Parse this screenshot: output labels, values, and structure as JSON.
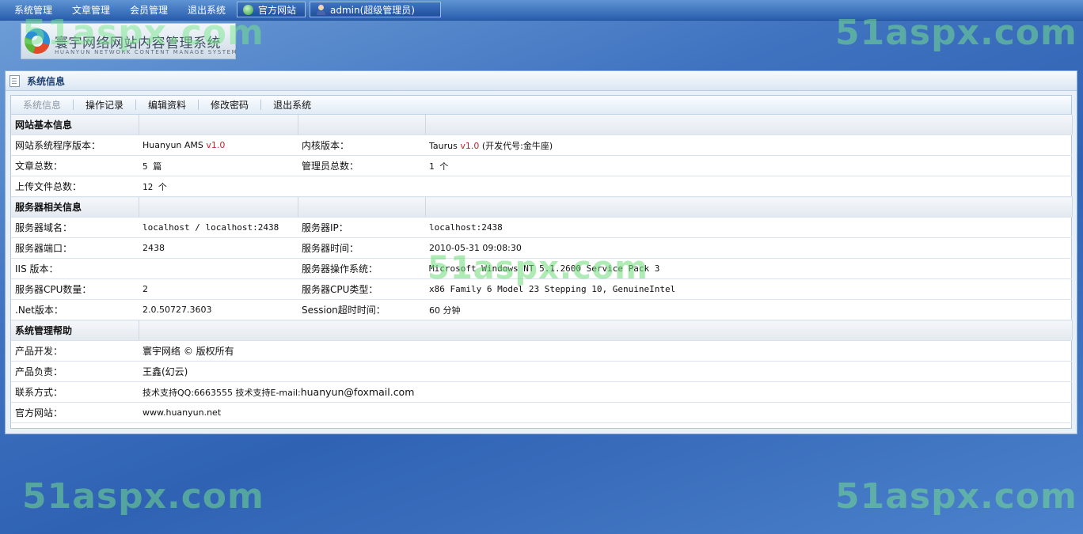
{
  "topbar": {
    "menu": [
      "系统管理",
      "文章管理",
      "会员管理",
      "退出系统"
    ],
    "official_site_button": "官方网站",
    "user_button": "admin(超级管理员)"
  },
  "logo": {
    "title": "寰宇网络网站内容管理系统",
    "subtitle": "HUANYUN NETWORK CONTENT MANAGE SYSTEM"
  },
  "watermarks": [
    "51aspx.com",
    "51aspx.com",
    "51aspx.com",
    "51aspx.com",
    "51aspx.com"
  ],
  "panel": {
    "title": "系统信息",
    "tabs": [
      "系统信息",
      "操作记录",
      "编辑资料",
      "修改密码",
      "退出系统"
    ]
  },
  "sections": {
    "basic": {
      "header": "网站基本信息",
      "program_version_label": "网站系统程序版本：",
      "program_version_name": "Huanyun AMS",
      "program_version_num": "v1.0",
      "kernel_version_label": "内核版本：",
      "kernel_name": "Taurus",
      "kernel_num": "v1.0",
      "kernel_codename": "(开发代号:金牛座)",
      "article_total_label": "文章总数：",
      "article_total": "5 篇",
      "admin_total_label": "管理员总数：",
      "admin_total": "1 个",
      "upload_total_label": "上传文件总数：",
      "upload_total": "12 个"
    },
    "server": {
      "header": "服务器相关信息",
      "domain_label": "服务器域名：",
      "domain": "localhost / localhost:2438",
      "ip_label": "服务器IP：",
      "ip": "localhost:2438",
      "port_label": "服务器端口：",
      "port": "2438",
      "time_label": "服务器时间：",
      "time": "2010-05-31 09:08:30",
      "iis_label": "IIS 版本：",
      "iis": "",
      "os_label": "服务器操作系统：",
      "os": "Microsoft Windows NT 5.1.2600 Service Pack 3",
      "cpu_count_label": "服务器CPU数量：",
      "cpu_count": "2",
      "cpu_type_label": "服务器CPU类型：",
      "cpu_type": "x86 Family 6 Model 23 Stepping 10, GenuineIntel",
      "net_label": ".Net版本：",
      "net": "2.0.50727.3603",
      "session_label": "Session超时时间：",
      "session": "60 分钟"
    },
    "help": {
      "header": "系统管理帮助",
      "developer_label": "产品开发：",
      "developer": "寰宇网络 © 版权所有",
      "owner_label": "产品负责：",
      "owner": "王鑫(幻云)",
      "contact_label": "联系方式：",
      "contact_prefix": "技术支持QQ:6663555 技术支持E-mail:",
      "contact_email": "huanyun@foxmail.com",
      "site_label": "官方网站：",
      "site": "www.huanyun.net"
    }
  }
}
